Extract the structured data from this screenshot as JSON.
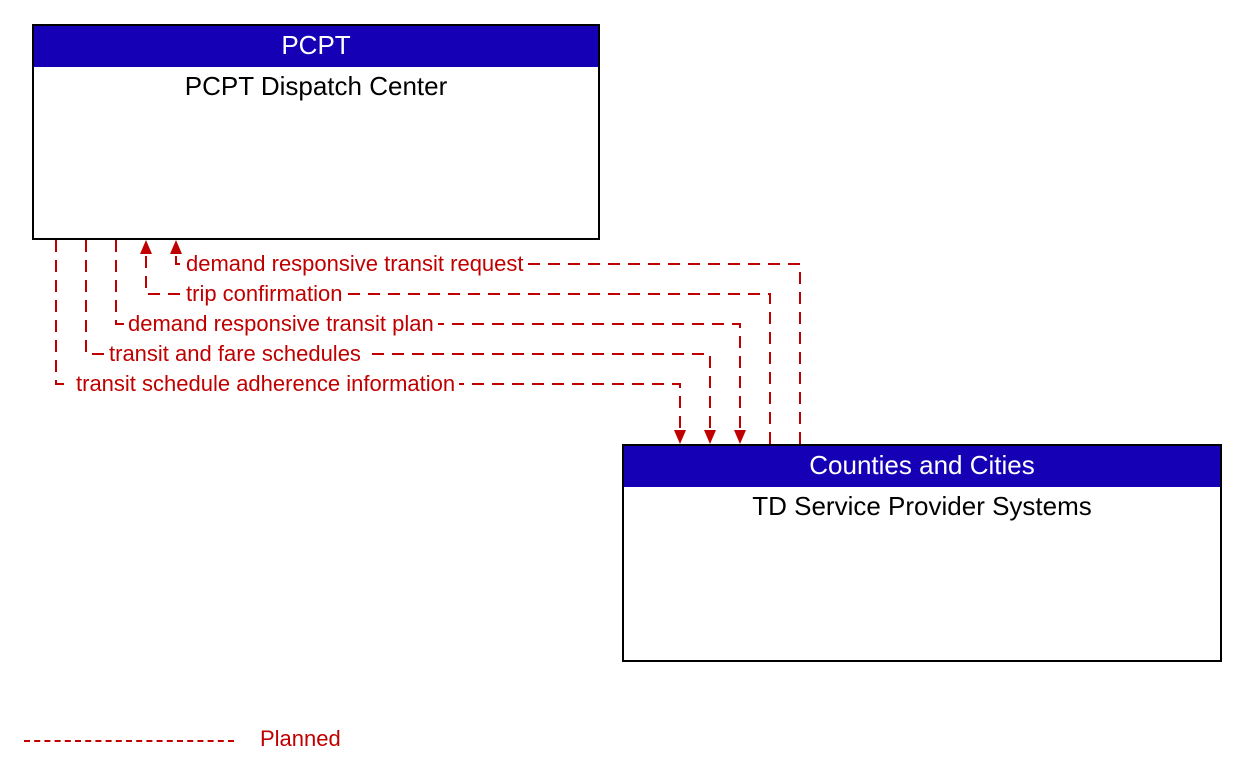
{
  "boxes": {
    "top": {
      "header": "PCPT",
      "title": "PCPT Dispatch Center"
    },
    "bottom": {
      "header": "Counties and Cities",
      "title": "TD Service Provider Systems"
    }
  },
  "flows": {
    "f1": "demand responsive transit request",
    "f2": "trip confirmation",
    "f3": "demand responsive transit plan",
    "f4": "transit and fare schedules",
    "f5": "transit schedule adherence information"
  },
  "legend": {
    "planned": "Planned"
  },
  "colors": {
    "header_bg": "#1600b6",
    "flow": "#c00000"
  }
}
